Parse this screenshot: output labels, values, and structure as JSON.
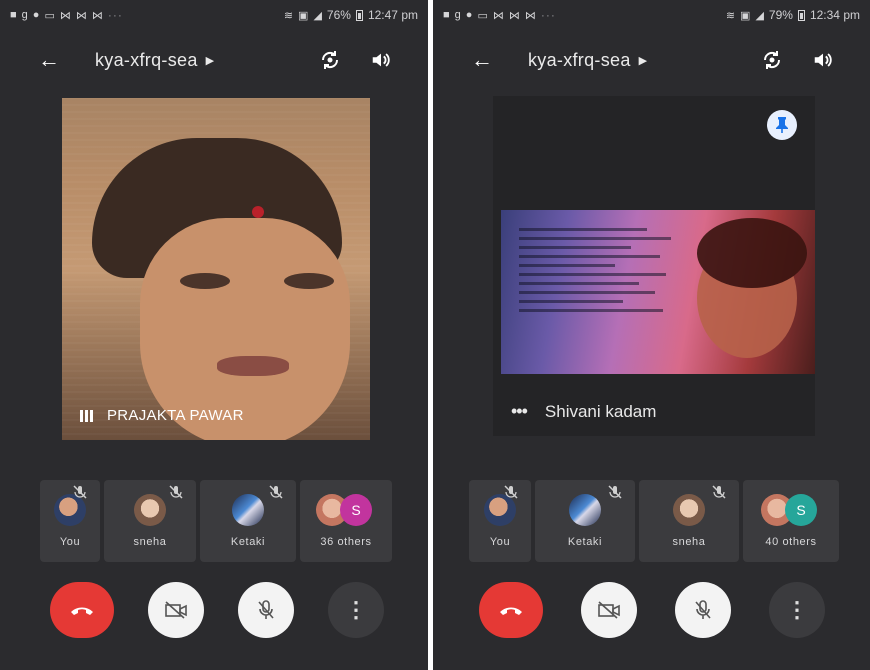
{
  "colors": {
    "end_call": "#e53935",
    "other_letter_left": "#c2349e",
    "other_letter_right": "#26a69a",
    "pin_badge": "#1a73e8"
  },
  "phones": [
    {
      "status": {
        "battery": "76%",
        "time": "12:47 pm"
      },
      "meeting_code": "kya-xfrq-sea",
      "main_tile": {
        "type": "camera",
        "name": "PRAJAKTA PAWAR"
      },
      "participants": [
        {
          "label": "You",
          "avatar": "photo-you",
          "muted": true
        },
        {
          "label": "sneha",
          "avatar": "photo-sneha",
          "muted": true
        },
        {
          "label": "Ketaki",
          "avatar": "photo-ketaki",
          "muted": true
        },
        {
          "label": "36 others",
          "avatar": "photo-plus-letter",
          "letter": "S"
        }
      ],
      "controls": [
        "end-call-icon",
        "camera-off-icon",
        "mic-off-icon",
        "more-vert-icon"
      ]
    },
    {
      "status": {
        "battery": "79%",
        "time": "12:34 pm"
      },
      "meeting_code": "kya-xfrq-sea",
      "main_tile": {
        "type": "presentation",
        "name": "Shivani kadam"
      },
      "participants": [
        {
          "label": "You",
          "avatar": "photo-you",
          "muted": true
        },
        {
          "label": "Ketaki",
          "avatar": "photo-ketaki",
          "muted": true
        },
        {
          "label": "sneha",
          "avatar": "photo-sneha",
          "muted": true
        },
        {
          "label": "40 others",
          "avatar": "photo-plus-letter",
          "letter": "S"
        }
      ],
      "controls": [
        "end-call-icon",
        "camera-off-icon",
        "mic-off-icon",
        "more-vert-icon"
      ]
    }
  ]
}
